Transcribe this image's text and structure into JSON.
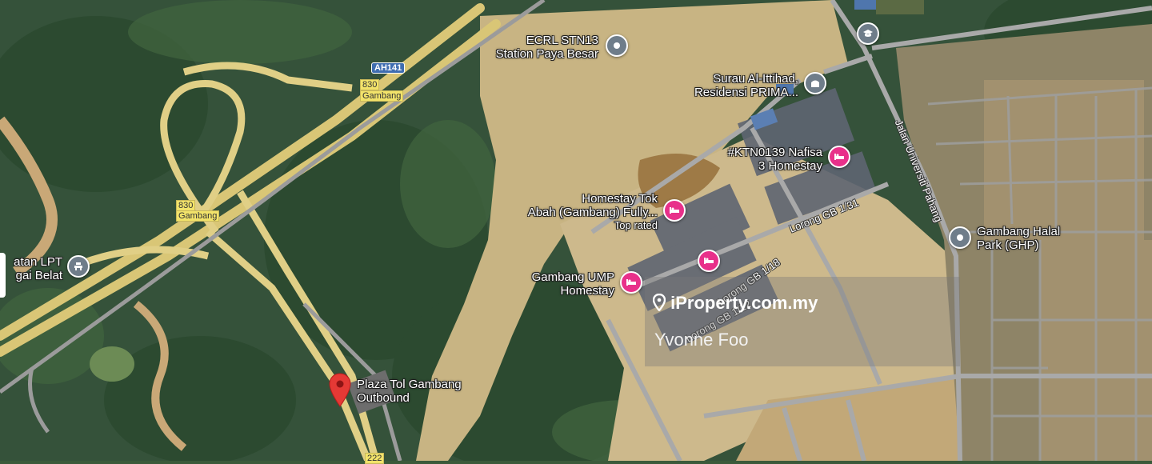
{
  "map": {
    "places": [
      {
        "name": "ecrl-station",
        "lines": [
          "ECRL STN13",
          "Station Paya Besar"
        ],
        "icon": "pin-gray-icon"
      },
      {
        "name": "surau",
        "lines": [
          "Surau Al-Ittihad,",
          "Residensi PRIMA..."
        ],
        "icon": "mosque-icon"
      },
      {
        "name": "nafisa-homestay",
        "lines": [
          "#KTN0139 Nafisa",
          "3 Homestay"
        ],
        "icon": "bed-icon"
      },
      {
        "name": "homestay-tok-abah",
        "lines": [
          "Homestay Tok",
          "Abah (Gambang) Fully..."
        ],
        "note": "Top rated",
        "icon": "bed-icon"
      },
      {
        "name": "gambang-ump-homestay",
        "lines": [
          "Gambang UMP",
          "Homestay"
        ],
        "icon": "bed-icon"
      },
      {
        "name": "gambang-halal-park",
        "lines": [
          "Gambang Halal",
          "Park (GHP)"
        ],
        "icon": "pin-gray-icon"
      },
      {
        "name": "plaza-tol",
        "lines": [
          "Plaza Tol Gambang",
          "Outbound"
        ],
        "icon": "red-marker-icon"
      },
      {
        "name": "lpt-rest-area",
        "lines": [
          "atan LPT",
          "gai Belat"
        ],
        "icon": "rest-area-icon"
      }
    ],
    "streets": {
      "jalan_universiti": "Jalan Universiti Pahang",
      "lorong_131": "Lorong GB 1/31",
      "lorong_118": "Lorong GB 1/18",
      "lorong_112": "Lorong GB 1/12"
    },
    "road_badges": {
      "ah141": "AH141",
      "exit830_a_num": "830",
      "exit830_a_name": "Gambang",
      "exit830_b_num": "830",
      "exit830_b_name": "Gambang",
      "route222": "222"
    },
    "colors": {
      "pin_pink": "#e8308a",
      "pin_gray": "#6f7d8a",
      "marker_red": "#e53935",
      "highway": "#f2e36a"
    }
  },
  "watermark": {
    "brand": "iProperty.com.my",
    "agent": "Yvonne Foo"
  }
}
